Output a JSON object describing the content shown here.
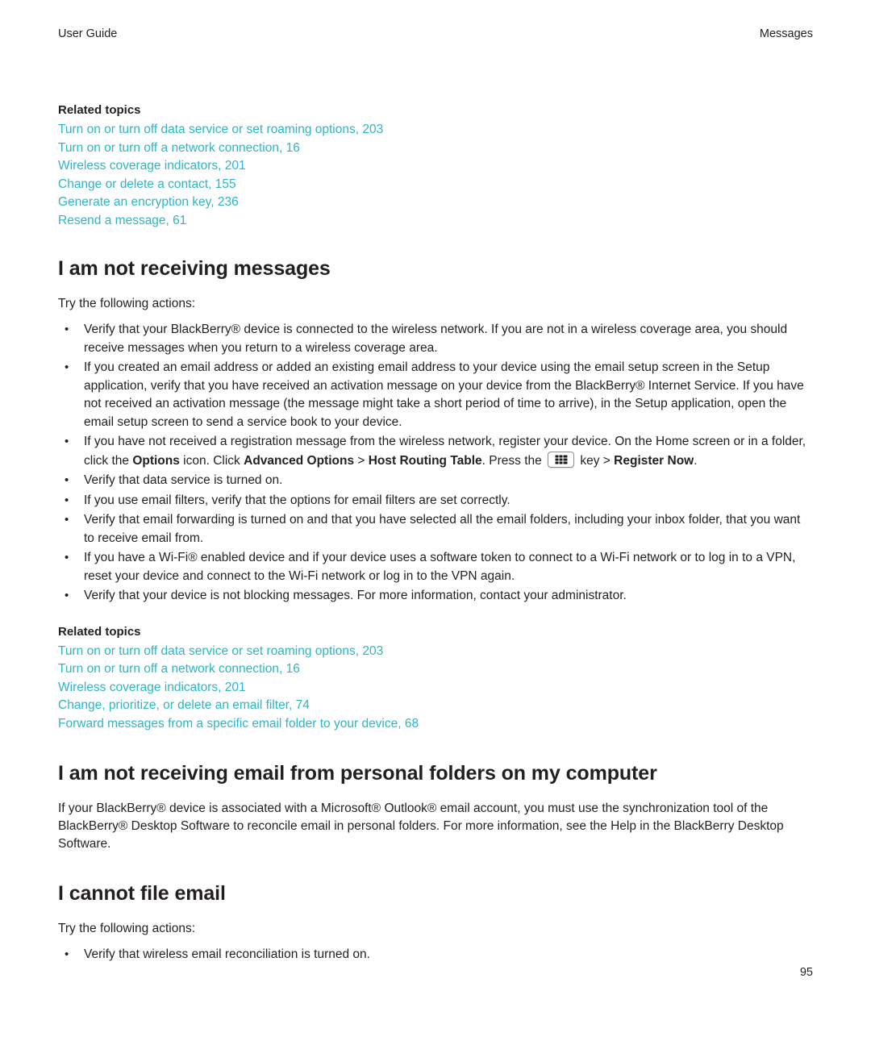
{
  "header": {
    "left": "User Guide",
    "right": "Messages"
  },
  "related_topics_label": "Related topics",
  "top_related_links": [
    "Turn on or turn off data service or set roaming options, 203",
    "Turn on or turn off a network connection, 16",
    "Wireless coverage indicators, 201",
    "Change or delete a contact, 155",
    "Generate an encryption key, 236",
    "Resend a message, 61"
  ],
  "sections": [
    {
      "title": "I am not receiving messages",
      "intro": "Try the following actions:",
      "bullets": [
        "Verify that your BlackBerry® device is connected to the wireless network. If you are not in a wireless coverage area, you should receive messages when you return to a wireless coverage area.",
        "If you created an email address or added an existing email address to your device using the email setup screen in the Setup application, verify that you have received an activation message on your device from the BlackBerry® Internet Service. If you have not received an activation message (the message might take a short period of time to arrive), in the Setup application, open the email setup screen to send a service book to your device.",
        "Verify that data service is turned on.",
        "If you use email filters, verify that the options for email filters are set correctly.",
        "Verify that email forwarding is turned on and that you have selected all the email folders, including your inbox folder, that you want to receive email from.",
        "If you have a Wi-Fi® enabled device and if your device uses a software token to connect to a Wi-Fi network or to log in to a VPN, reset your device and connect to the Wi-Fi network or log in to the VPN again.",
        "Verify that your device is not blocking messages. For more information, contact your administrator."
      ],
      "registration_bullet": {
        "part1": "If you have not received a registration message from the wireless network, register your device. On the Home screen or in a folder, click the ",
        "bold1": "Options",
        "part2": " icon. Click ",
        "bold2": "Advanced Options",
        "part3": " > ",
        "bold3": "Host Routing Table",
        "part4": ". Press the ",
        "icon_name": "menu-key-icon",
        "part5": " key > ",
        "bold4": "Register Now",
        "part6": "."
      },
      "related_links": [
        "Turn on or turn off data service or set roaming options, 203",
        "Turn on or turn off a network connection, 16",
        "Wireless coverage indicators, 201",
        "Change, prioritize, or delete an email filter, 74",
        "Forward messages from a specific email folder to your device, 68"
      ]
    },
    {
      "title": "I am not receiving email from personal folders on my computer",
      "paragraph": "If your BlackBerry® device is associated with a Microsoft® Outlook® email account, you must use the synchronization tool of the BlackBerry® Desktop Software to reconcile email in personal folders. For more information, see the Help in the BlackBerry Desktop Software."
    },
    {
      "title": "I cannot file email",
      "intro": "Try the following actions:",
      "bullets": [
        "Verify that wireless email reconciliation is turned on."
      ]
    }
  ],
  "page_number": "95",
  "colors": {
    "link": "#2db5c8",
    "text": "#231f20"
  }
}
